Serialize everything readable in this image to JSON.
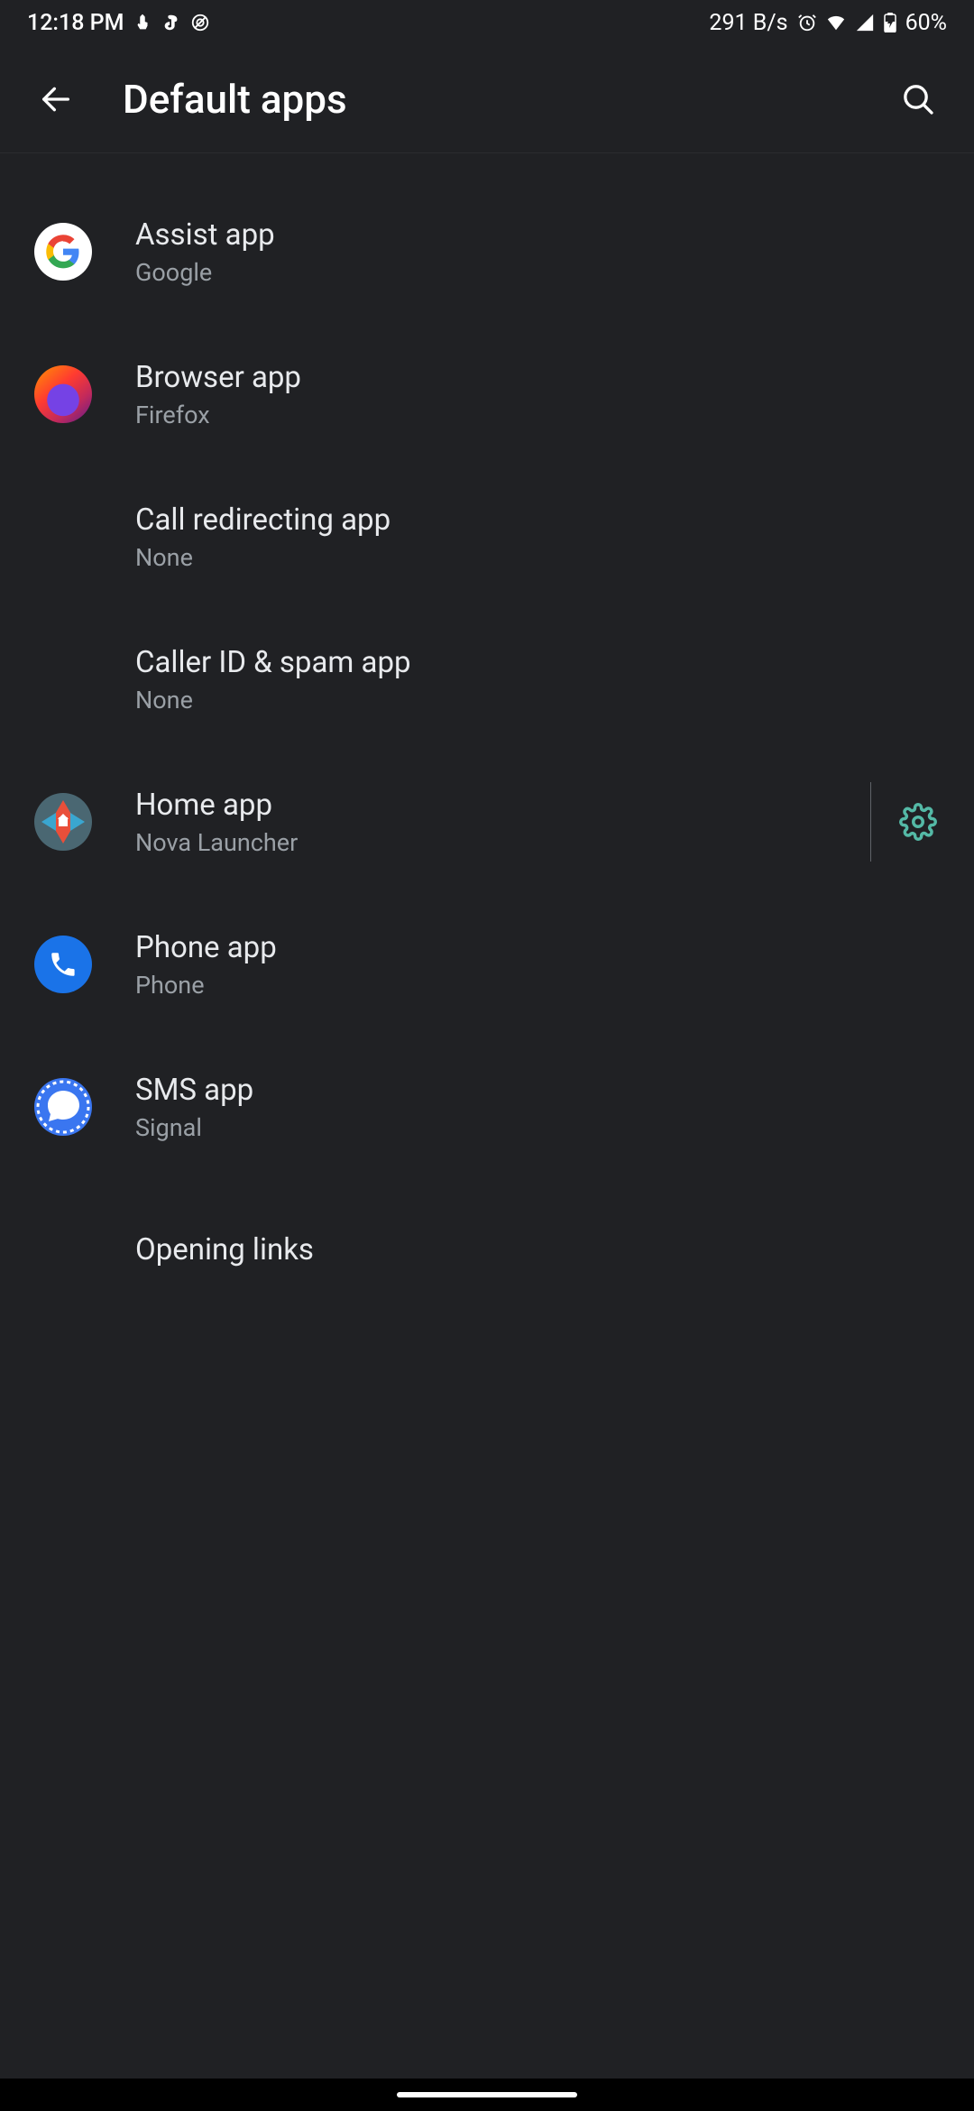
{
  "status": {
    "time": "12:18 PM",
    "net_speed": "291 B/s",
    "battery": "60%"
  },
  "header": {
    "title": "Default apps"
  },
  "items": {
    "assist": {
      "title": "Assist app",
      "value": "Google"
    },
    "browser": {
      "title": "Browser app",
      "value": "Firefox"
    },
    "callredir": {
      "title": "Call redirecting app",
      "value": "None"
    },
    "callerid": {
      "title": "Caller ID & spam app",
      "value": "None"
    },
    "home": {
      "title": "Home app",
      "value": "Nova Launcher"
    },
    "phone": {
      "title": "Phone app",
      "value": "Phone"
    },
    "sms": {
      "title": "SMS app",
      "value": "Signal"
    },
    "opening": {
      "title": "Opening links"
    }
  }
}
